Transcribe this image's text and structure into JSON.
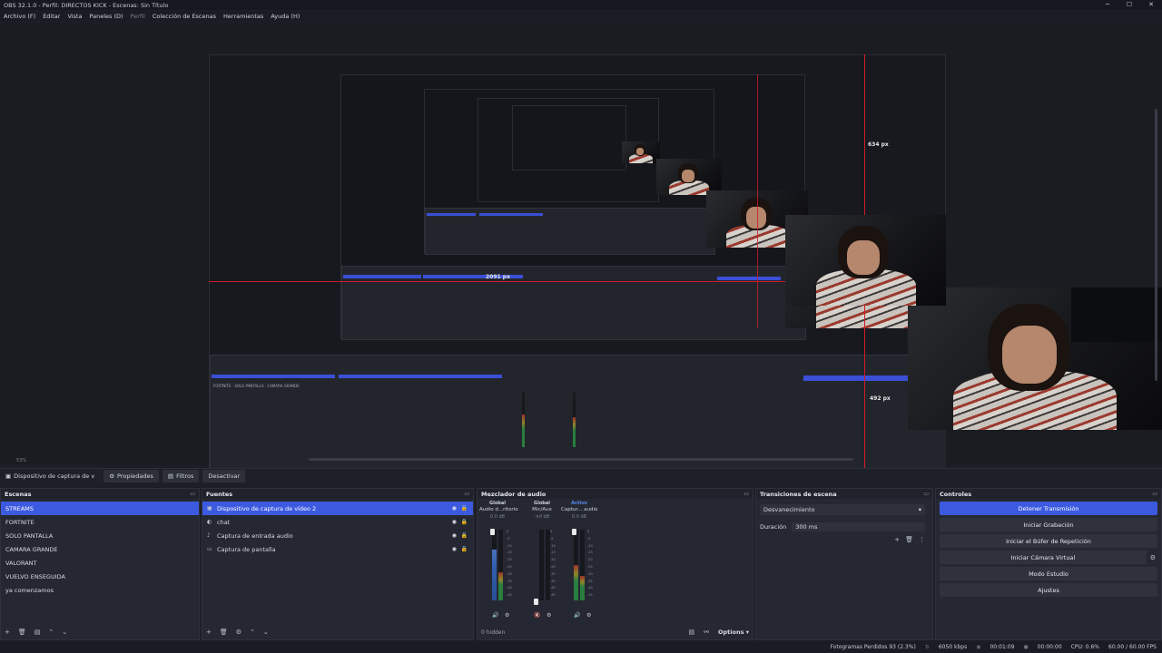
{
  "window": {
    "title": "OBS 32.1.0 - Perfil: DIRECTOS KICK - Escenas: Sin Título",
    "minimize": "─",
    "maximize": "☐",
    "close": "✕"
  },
  "menu": [
    {
      "label": "Archivo (F)",
      "dim": false
    },
    {
      "label": "Editar",
      "dim": false
    },
    {
      "label": "Vista",
      "dim": false
    },
    {
      "label": "Paneles (D)",
      "dim": false
    },
    {
      "label": "Perfil",
      "dim": true
    },
    {
      "label": "Colección de Escenas",
      "dim": false
    },
    {
      "label": "Herramientas",
      "dim": false
    },
    {
      "label": "Ayuda (H)",
      "dim": false
    }
  ],
  "preview": {
    "measure_height": "634 px",
    "measure_width": "2091 px",
    "measure_small": "492 px",
    "zoom": "53%"
  },
  "source_toolbar": {
    "selected_source": "Dispositivo de captura de v",
    "properties": "Propiedades",
    "filters": "Filtros",
    "deactivate": "Desactivar"
  },
  "scenes": {
    "title": "Escenas",
    "items": [
      "STREAMS",
      "FORTNITE",
      "SOLO PANTALLA",
      "CAMARA GRANDE",
      "VALORANT",
      "VUELVO ENSEGUIDA",
      "ya comenzamos"
    ]
  },
  "sources": {
    "title": "Fuentes",
    "items": [
      {
        "name": "Dispositivo de captura de vídeo 2",
        "icon": "camera-icon"
      },
      {
        "name": "chat",
        "icon": "browser-icon"
      },
      {
        "name": "Captura de entrada audio",
        "icon": "mic-icon"
      },
      {
        "name": "Captura de pantalla",
        "icon": "monitor-icon"
      }
    ]
  },
  "mixer": {
    "title": "Mezclador de audio",
    "channels": [
      {
        "scope": "Global",
        "name": "Audio d...ritorio",
        "db": "0.0 dB"
      },
      {
        "scope": "Global",
        "name": "Mic/Aux",
        "db": "-inf dB"
      },
      {
        "scope": "Activo",
        "name": "Captur... audio",
        "db": "0.0 dB"
      }
    ],
    "hidden": "0 hidden",
    "options": "Options"
  },
  "transitions": {
    "title": "Transiciones de escena",
    "selected": "Desvanecimiento",
    "duration_label": "Duración",
    "duration_value": "300 ms"
  },
  "controls": {
    "title": "Controles",
    "buttons": [
      "Detener Transmisión",
      "Iniciar Grabación",
      "Iniciar el Búfer de Repetición",
      "Iniciar Cámara Virtual",
      "Modo Estudio",
      "Ajustes"
    ]
  },
  "status": {
    "dropped": "Fotogramas Perdidos 93 (2.3%)",
    "bitrate": "6050 kbps",
    "stream_time": "00:01:09",
    "rec_time": "00:00:00",
    "cpu": "CPU: 0.6%",
    "fps": "60.00 / 60.00 FPS"
  },
  "colors": {
    "accent": "#3c5ae0",
    "measure_line": "#d21a2a",
    "panel": "#252832",
    "background": "#1d1f26"
  }
}
